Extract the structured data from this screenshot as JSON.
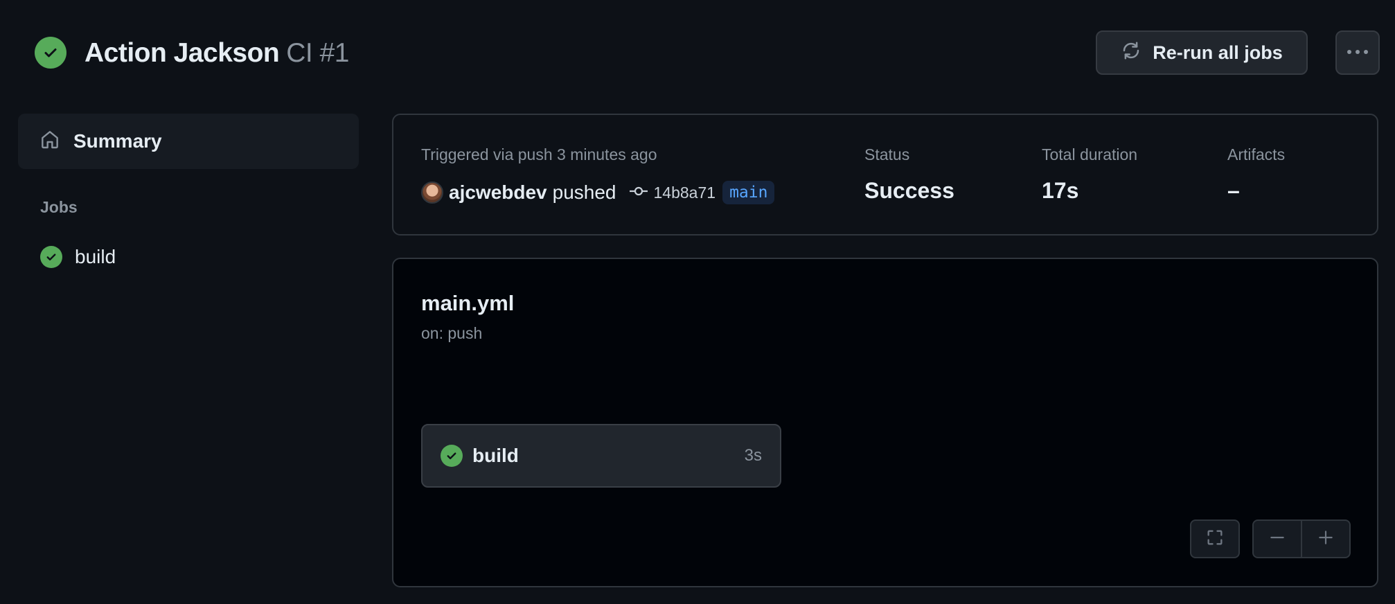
{
  "header": {
    "workflow_name": "Action Jackson",
    "run_label": "CI #1",
    "rerun_button": "Re-run all jobs",
    "status_icon": "check-circle-icon"
  },
  "sidebar": {
    "summary_label": "Summary",
    "jobs_heading": "Jobs",
    "jobs": [
      {
        "label": "build",
        "status": "success"
      }
    ]
  },
  "summary": {
    "trigger_text": "Triggered via push 3 minutes ago",
    "actor": "ajcwebdev",
    "action": "pushed",
    "commit_sha": "14b8a71",
    "branch": "main",
    "status_label": "Status",
    "status_value": "Success",
    "duration_label": "Total duration",
    "duration_value": "17s",
    "artifacts_label": "Artifacts",
    "artifacts_value": "–"
  },
  "graph": {
    "file_name": "main.yml",
    "trigger": "on: push",
    "jobs": [
      {
        "name": "build",
        "duration": "3s",
        "status": "success"
      }
    ]
  },
  "colors": {
    "success": "#57ab5a",
    "background": "#0d1117",
    "branch_text": "#58a6ff"
  }
}
